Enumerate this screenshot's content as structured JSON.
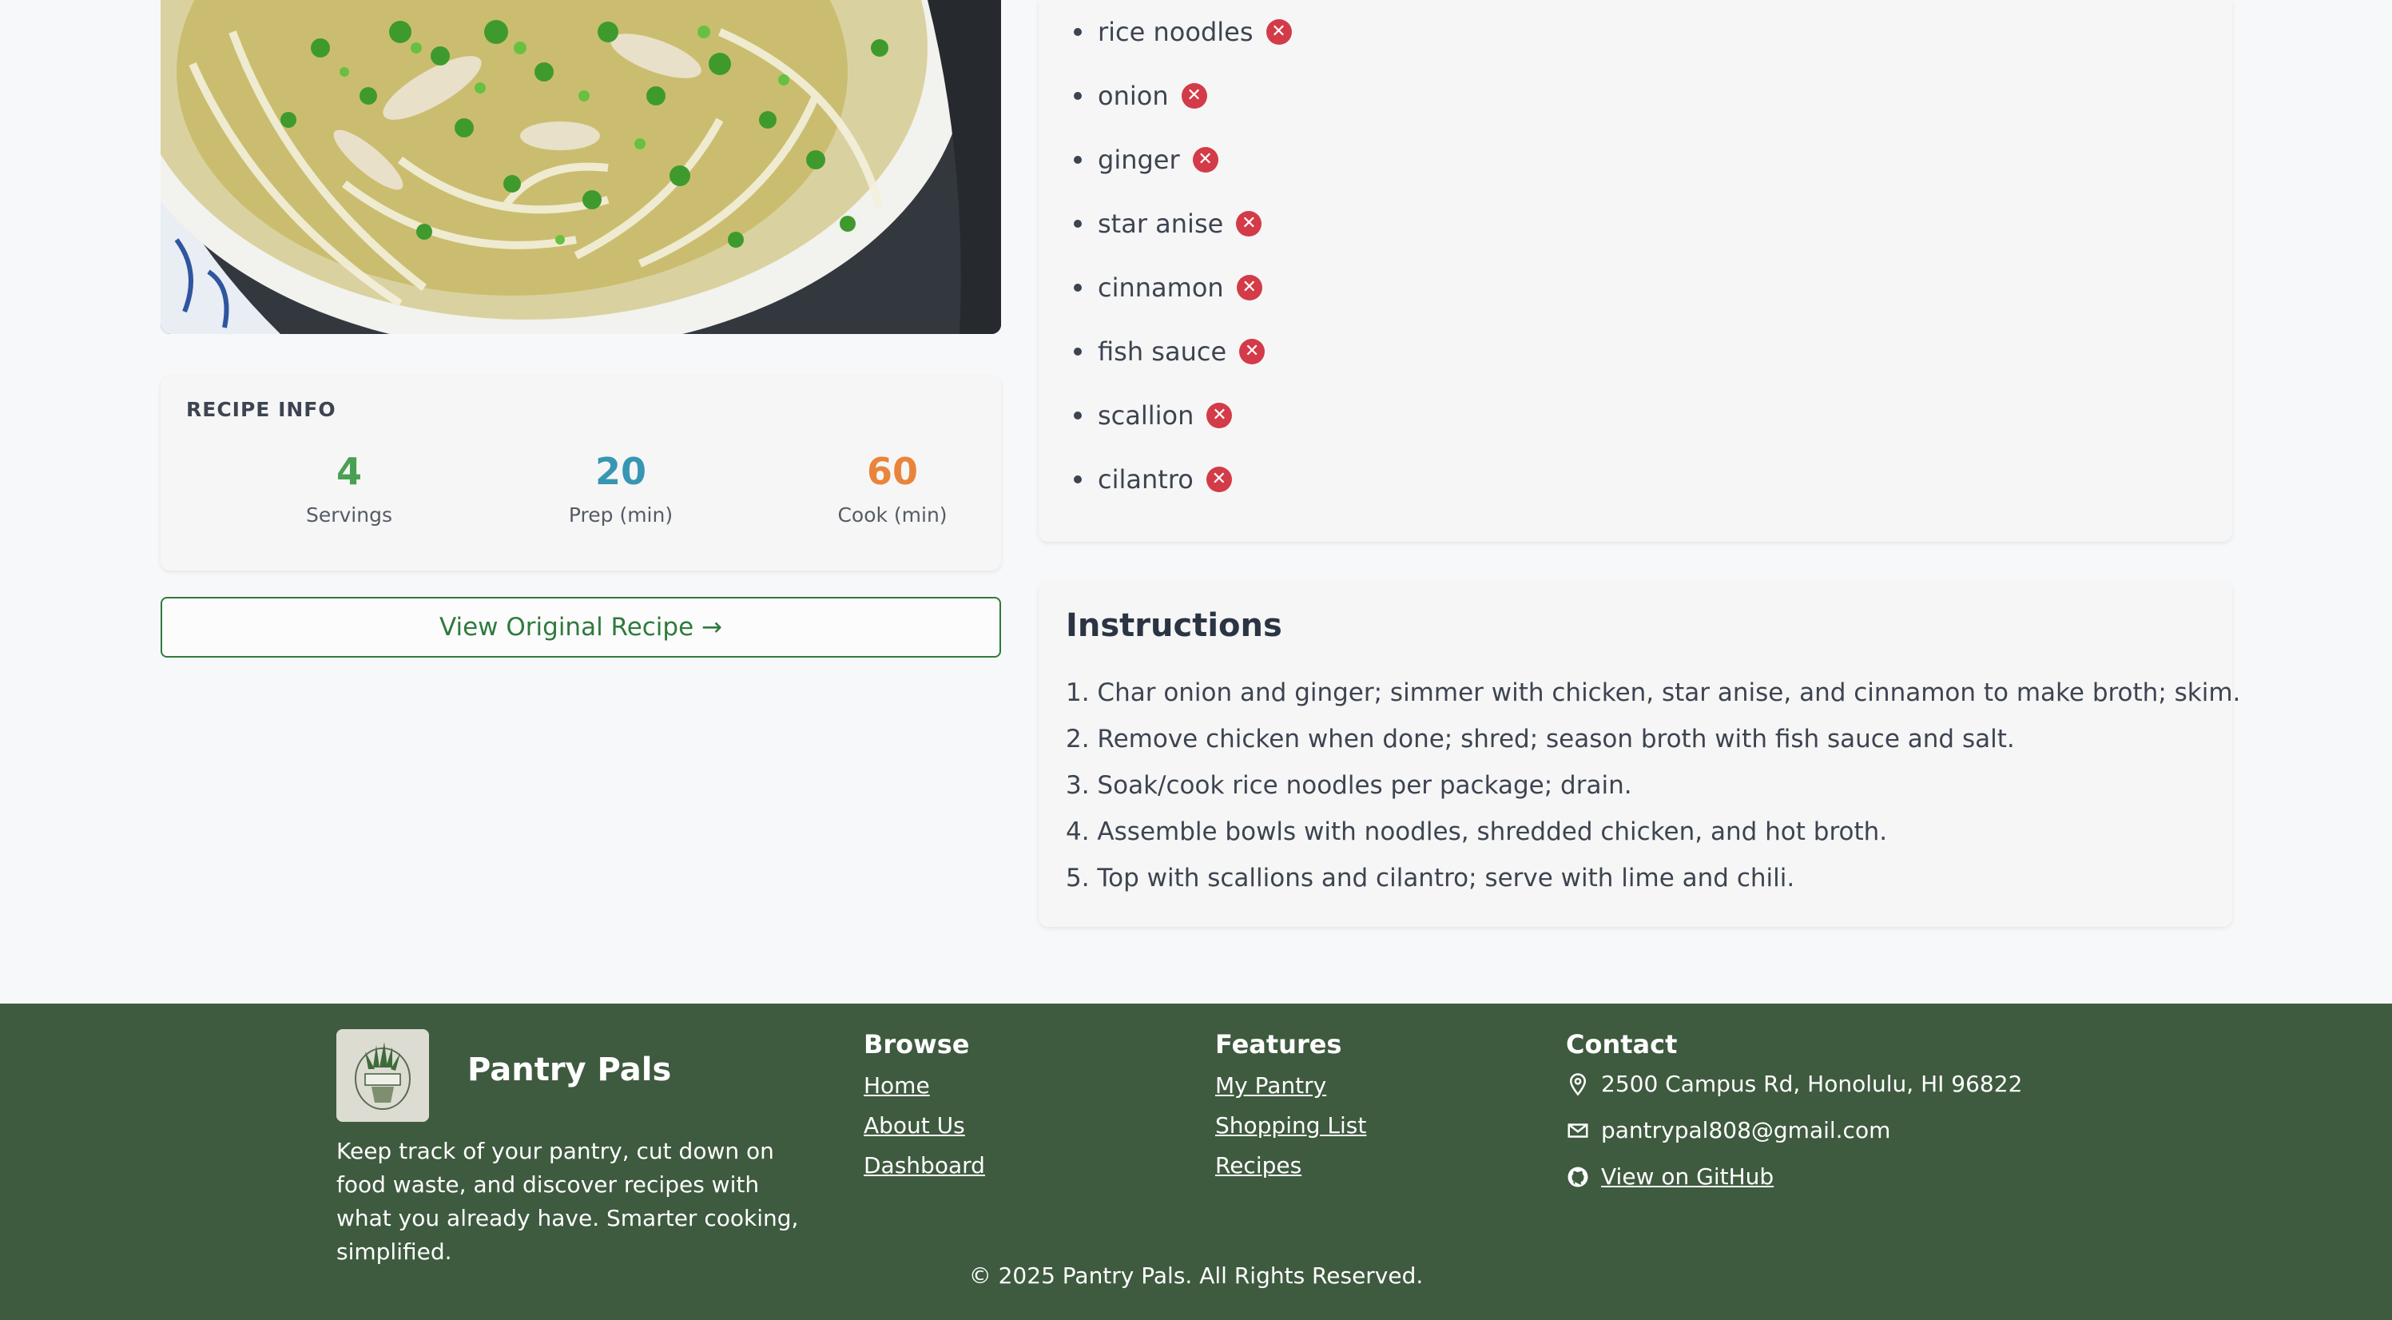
{
  "recipe_info": {
    "title": "RECIPE INFO",
    "stats": [
      {
        "value": "4",
        "label": "Servings",
        "color": "#4aa052"
      },
      {
        "value": "20",
        "label": "Prep (min)",
        "color": "#3896b3"
      },
      {
        "value": "60",
        "label": "Cook (min)",
        "color": "#e8853b"
      }
    ]
  },
  "view_recipe_label": "View Original Recipe →",
  "ingredients": [
    "rice noodles",
    "onion",
    "ginger",
    "star anise",
    "cinnamon",
    "fish sauce",
    "scallion",
    "cilantro"
  ],
  "remove_icon": "✕",
  "instructions": {
    "title": "Instructions",
    "steps": [
      "1. Char onion and ginger; simmer with chicken, star anise, and cinnamon to make broth; skim.",
      "2. Remove chicken when done; shred; season broth with fish sauce and salt.",
      "3. Soak/cook rice noodles per package; drain.",
      "4. Assemble bowls with noodles, shredded chicken, and hot broth.",
      "5. Top with scallions and cilantro; serve with lime and chili."
    ]
  },
  "footer": {
    "brand": "Pantry Pals",
    "logo_text": "PANTRY PALS",
    "tagline": "Keep track of your pantry, cut down on food waste, and discover recipes with what you already have. Smarter cooking, simplified.",
    "browse": {
      "title": "Browse",
      "links": [
        "Home",
        "About Us",
        "Dashboard"
      ]
    },
    "features": {
      "title": "Features",
      "links": [
        "My Pantry",
        "Shopping List",
        "Recipes"
      ]
    },
    "contact": {
      "title": "Contact",
      "address": "2500 Campus Rd, Honolulu, HI 96822",
      "email": "pantrypal808@gmail.com",
      "github": "View on GitHub"
    },
    "copyright": "© 2025 Pantry Pals. All Rights Reserved."
  },
  "colors": {
    "accent_green": "#2f7a3e",
    "footer_bg": "#3e5a3f",
    "remove_red": "#d33b48"
  }
}
